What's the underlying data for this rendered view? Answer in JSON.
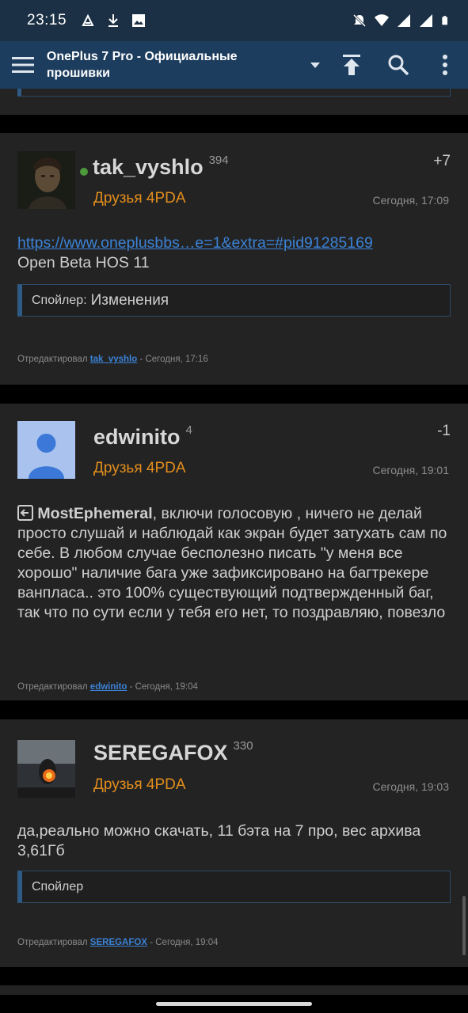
{
  "status_bar": {
    "time": "23:15",
    "left_icons": [
      "rewind-notification-icon",
      "download-icon",
      "image-icon"
    ],
    "right_icons": [
      "mute-icon",
      "wifi-icon",
      "signal-icon",
      "signal-icon-2",
      "battery-icon"
    ]
  },
  "app_bar": {
    "title": "OnePlus 7 Pro - Официальные прошивки",
    "icons": [
      "menu-icon",
      "dropdown-icon",
      "scroll-top-icon",
      "search-icon",
      "more-vert-icon"
    ],
    "color": "#1d3d5e"
  },
  "posts": [
    {
      "nick": "tak_vyshlo",
      "online": true,
      "reputation": "394",
      "karma": "+7",
      "group": "Друзья 4PDA",
      "date": "Сегодня, 17:09",
      "link": "https://www.oneplusbbs…e=1&extra=#pid91285169",
      "text": "Open Beta HOS 11",
      "spoiler_label": "Спойлер:",
      "spoiler_value": "Изменения",
      "edited_prefix": "Отредактировал",
      "edited_by": "tak_vyshlo",
      "edited_time": "- Сегодня, 17:16"
    },
    {
      "nick": "edwinito",
      "online": false,
      "reputation": "4",
      "karma": "-1",
      "group": "Друзья 4PDA",
      "date": "Сегодня, 19:01",
      "quote_nick": "MostEphemeral",
      "text": ", включи голосовую , ничего не делай просто слушай и наблюдай как экран будет затухать сам по себе. В любом случае бесполезно писать \"у меня все хорошо\" наличие бага уже зафиксировано на багтрекере ванпласа.. это 100% существующий подтвержденный баг, так что по сути если у тебя его нет, то поздравляю, повезло",
      "edited_prefix": "Отредактировал",
      "edited_by": "edwinito",
      "edited_time": "- Сегодня, 19:04"
    },
    {
      "nick": "SEREGAFOX",
      "online": false,
      "reputation": "330",
      "karma": "",
      "group": "Друзья 4PDA",
      "date": "Сегодня, 19:03",
      "text": "да,реально можно скачать, 11 бэта на 7 про, вес архива 3,61Гб",
      "spoiler_label": "Спойлер",
      "edited_prefix": "Отредактировал",
      "edited_by": "SEREGAFOX",
      "edited_time": "- Сегодня, 19:04"
    }
  ],
  "colors": {
    "group": "#e38e1c",
    "link": "#3b82d6",
    "card": "#232323",
    "online": "#4c9a3a"
  }
}
